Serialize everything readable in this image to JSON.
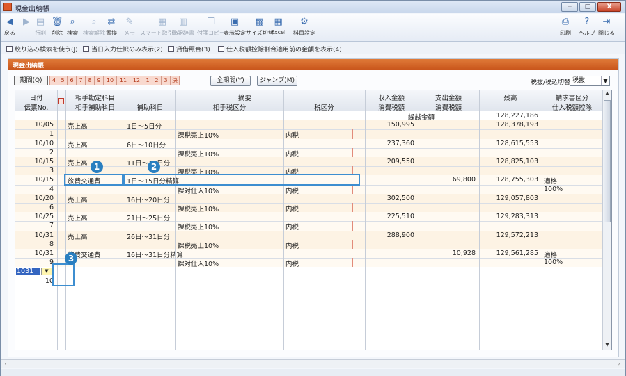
{
  "window": {
    "title": "現金出納帳",
    "minimize": "─",
    "maximize": "□",
    "close": "X"
  },
  "toolbar": {
    "left": [
      {
        "label": "戻る",
        "icon": "back-arrow-icon",
        "glyph": "◀",
        "dim": false
      },
      {
        "label": "",
        "icon": "forward-arrow-icon",
        "glyph": "▶",
        "dim": true
      },
      {
        "label": "行削",
        "icon": "delete-row-icon",
        "glyph": "▤",
        "dim": true
      },
      {
        "label": "削除",
        "icon": "trash-icon",
        "glyph": "🗑",
        "dim": false
      },
      {
        "label": "検索",
        "icon": "search-icon",
        "glyph": "⌕",
        "dim": false
      },
      {
        "label": "検索解除",
        "icon": "search-clear-icon",
        "glyph": "⌕",
        "dim": true
      },
      {
        "label": "置換",
        "icon": "replace-icon",
        "glyph": "⇄",
        "dim": false
      },
      {
        "label": "メモ",
        "icon": "memo-icon",
        "glyph": "✎",
        "dim": true
      },
      {
        "label": "スマート取引取込",
        "icon": "smart-import-icon",
        "glyph": "▦",
        "dim": true
      },
      {
        "label": "仕訳辞書",
        "icon": "dictionary-icon",
        "glyph": "▥",
        "dim": true
      },
      {
        "label": "付箋コピー",
        "icon": "copy-icon",
        "glyph": "❐",
        "dim": true
      },
      {
        "label": "表示設定",
        "icon": "display-settings-icon",
        "glyph": "▣",
        "dim": false
      },
      {
        "label": "サイズ切替",
        "icon": "resize-icon",
        "glyph": "▩",
        "dim": false
      },
      {
        "label": "Excel",
        "icon": "excel-icon",
        "glyph": "▦",
        "dim": false
      },
      {
        "label": "科目設定",
        "icon": "account-settings-icon",
        "glyph": "⚙",
        "dim": false
      }
    ],
    "right": [
      {
        "label": "印刷",
        "icon": "print-icon",
        "glyph": "⎙"
      },
      {
        "label": "ヘルプ",
        "icon": "help-icon",
        "glyph": "?"
      },
      {
        "label": "閉じる",
        "icon": "close-door-icon",
        "glyph": "⇥"
      }
    ]
  },
  "options": [
    "絞り込み検索を使う(J)",
    "当日入力仕訳のみ表示(2)",
    "貸借照合(3)",
    "仕入税額控除割合適用前の金額を表示(4)"
  ],
  "panel": {
    "title": "現金出納帳",
    "period_button": "期間(Q)",
    "months": [
      "4",
      "5",
      "6",
      "7",
      "8",
      "9",
      "10",
      "11",
      "12",
      "1",
      "2",
      "3",
      "決"
    ],
    "all_period_button": "全期間(Y)",
    "jump_button": "ジャンプ(M)",
    "tax_label": "税抜/税込切替(Z):",
    "tax_select": "税抜"
  },
  "headers": {
    "row1": [
      "日付",
      "相手勘定科目",
      "摘要",
      "収入金額",
      "支出金額",
      "残高",
      "請求書区分"
    ],
    "row2": [
      "伝票No.",
      "相手補助科目",
      "補助科目",
      "相手税区分",
      "税区分",
      "消費税額",
      "消費税額",
      "仕入税額控除"
    ]
  },
  "carry": {
    "label": "繰越金額",
    "balance": "128,227,186"
  },
  "entries": [
    {
      "date": "10/05",
      "no": "1",
      "account": "売上高",
      "memo": "1日～5日分",
      "tax": "課税売上10%",
      "taxtype": "内税",
      "income": "150,995",
      "expense": "",
      "balance": "128,378,193",
      "invoice": "",
      "deduct": ""
    },
    {
      "date": "10/10",
      "no": "2",
      "account": "売上高",
      "memo": "6日～10日分",
      "tax": "課税売上10%",
      "taxtype": "内税",
      "income": "237,360",
      "expense": "",
      "balance": "128,615,553",
      "invoice": "",
      "deduct": ""
    },
    {
      "date": "10/15",
      "no": "3",
      "account": "売上高",
      "memo": "11日～15日分",
      "tax": "課税売上10%",
      "taxtype": "内税",
      "income": "209,550",
      "expense": "",
      "balance": "128,825,103",
      "invoice": "",
      "deduct": ""
    },
    {
      "date": "10/15",
      "no": "4",
      "account": "旅費交通費",
      "memo": "1日～15日分精算",
      "tax": "課対仕入10%",
      "taxtype": "内税",
      "income": "",
      "expense": "69,800",
      "balance": "128,755,303",
      "invoice": "適格",
      "deduct": "100%"
    },
    {
      "date": "10/20",
      "no": "6",
      "account": "売上高",
      "memo": "16日～20日分",
      "tax": "課税売上10%",
      "taxtype": "内税",
      "income": "302,500",
      "expense": "",
      "balance": "129,057,803",
      "invoice": "",
      "deduct": ""
    },
    {
      "date": "10/25",
      "no": "7",
      "account": "売上高",
      "memo": "21日～25日分",
      "tax": "課税売上10%",
      "taxtype": "内税",
      "income": "225,510",
      "expense": "",
      "balance": "129,283,313",
      "invoice": "",
      "deduct": ""
    },
    {
      "date": "10/31",
      "no": "8",
      "account": "売上高",
      "memo": "26日～31日分",
      "tax": "課税売上10%",
      "taxtype": "内税",
      "income": "288,900",
      "expense": "",
      "balance": "129,572,213",
      "invoice": "",
      "deduct": ""
    },
    {
      "date": "10/31",
      "no": "9",
      "account": "旅費交通費",
      "memo": "16日～31日分精算",
      "tax": "課対仕入10%",
      "taxtype": "内税",
      "income": "",
      "expense": "10,928",
      "balance": "129,561,285",
      "invoice": "適格",
      "deduct": "100%"
    }
  ],
  "new_row": {
    "date": "1031",
    "no": "10"
  },
  "callouts": [
    "1",
    "2",
    "3"
  ]
}
